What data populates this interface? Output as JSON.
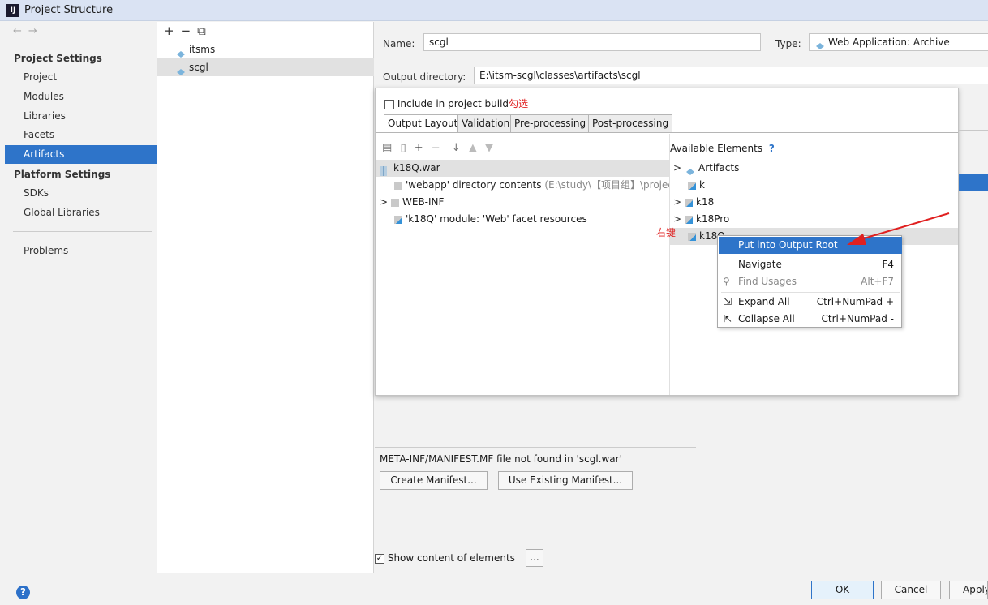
{
  "window": {
    "title": "Project Structure",
    "app_icon": "IJ"
  },
  "nav": {
    "back": "←",
    "forward": "→",
    "project_settings_header": "Project Settings",
    "items": [
      "Project",
      "Modules",
      "Libraries",
      "Facets"
    ],
    "selected": "Artifacts",
    "platform_settings_header": "Platform Settings",
    "platform_items": [
      "SDKs",
      "Global Libraries"
    ],
    "problems": "Problems"
  },
  "artifacts_list": {
    "toolbar": {
      "add": "+",
      "remove": "−",
      "copy": "⧉"
    },
    "items": [
      "itsms",
      "scgl"
    ]
  },
  "artifact": {
    "name_label": "Name:",
    "name_value": "scgl",
    "type_label": "Type:",
    "type_value": "Web Application: Archive",
    "output_dir_label": "Output directory:",
    "output_dir_value": "E:\\itsm-scgl\\classes\\artifacts\\scgl"
  },
  "popup": {
    "include_label": "Include in project build",
    "include_annotation": "勾选",
    "tabs": [
      "Output Layout",
      "Validation",
      "Pre-processing",
      "Post-processing"
    ],
    "available_label": "Available Elements",
    "available_help": "?",
    "output_tree": [
      {
        "label": "k18Q.war",
        "muted": ""
      },
      {
        "label": "'webapp' directory contents",
        "muted": " (E:\\study\\【项目组】\\projec"
      },
      {
        "label": "WEB-INF",
        "muted": ""
      },
      {
        "label": "'k18Q' module: 'Web' facet resources",
        "muted": ""
      }
    ],
    "available_tree": [
      "Artifacts",
      "k",
      "k18",
      "k18Pro",
      "k18Q"
    ],
    "right_click_annotation": "右键"
  },
  "context_menu": {
    "items": [
      {
        "label": "Put into Output Root",
        "key": ""
      },
      {
        "label": "Navigate",
        "key": "F4"
      },
      {
        "label": "Find Usages",
        "key": "Alt+F7"
      },
      {
        "label": "Expand All",
        "key": "Ctrl+NumPad +"
      },
      {
        "label": "Collapse All",
        "key": "Ctrl+NumPad -"
      }
    ]
  },
  "manifest": {
    "message": "META-INF/MANIFEST.MF file not found in 'scgl.war'",
    "create_button": "Create Manifest...",
    "use_existing_button": "Use Existing Manifest..."
  },
  "show_content_label": "Show content of elements",
  "ellipsis_button": "...",
  "buttons": {
    "ok": "OK",
    "cancel": "Cancel",
    "apply": "Apply"
  },
  "help": "?",
  "colors": {
    "accent": "#2e74c9",
    "annotation": "#e02020",
    "selection_gray": "#e1e1e1"
  }
}
